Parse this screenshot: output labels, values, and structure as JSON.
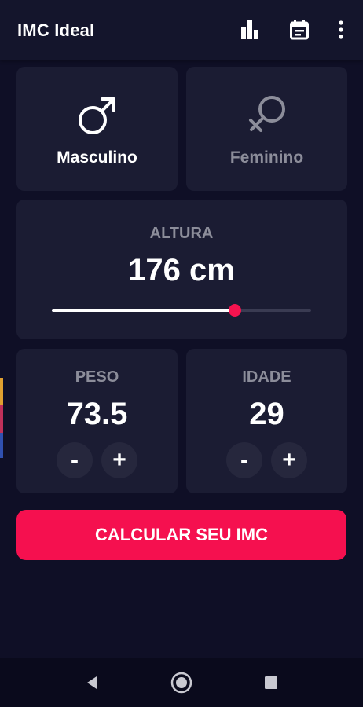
{
  "appbar": {
    "title": "IMC Ideal",
    "icons": [
      "bar-chart-icon",
      "calendar-icon",
      "more-vert-icon"
    ]
  },
  "gender": {
    "male_label": "Masculino",
    "female_label": "Feminino",
    "selected": "Masculino"
  },
  "height": {
    "label": "ALTURA",
    "value_text": "176 cm",
    "slider_fraction": 0.705
  },
  "weight": {
    "label": "PESO",
    "value": "73.5",
    "minus": "-",
    "plus": "+"
  },
  "age": {
    "label": "IDADE",
    "value": "29",
    "minus": "-",
    "plus": "+"
  },
  "calculate_button": "CALCULAR SEU IMC",
  "colors": {
    "background": "#0f0f26",
    "card": "#1b1c33",
    "accent": "#f5104f",
    "inactive_text": "#8c8d9a"
  }
}
